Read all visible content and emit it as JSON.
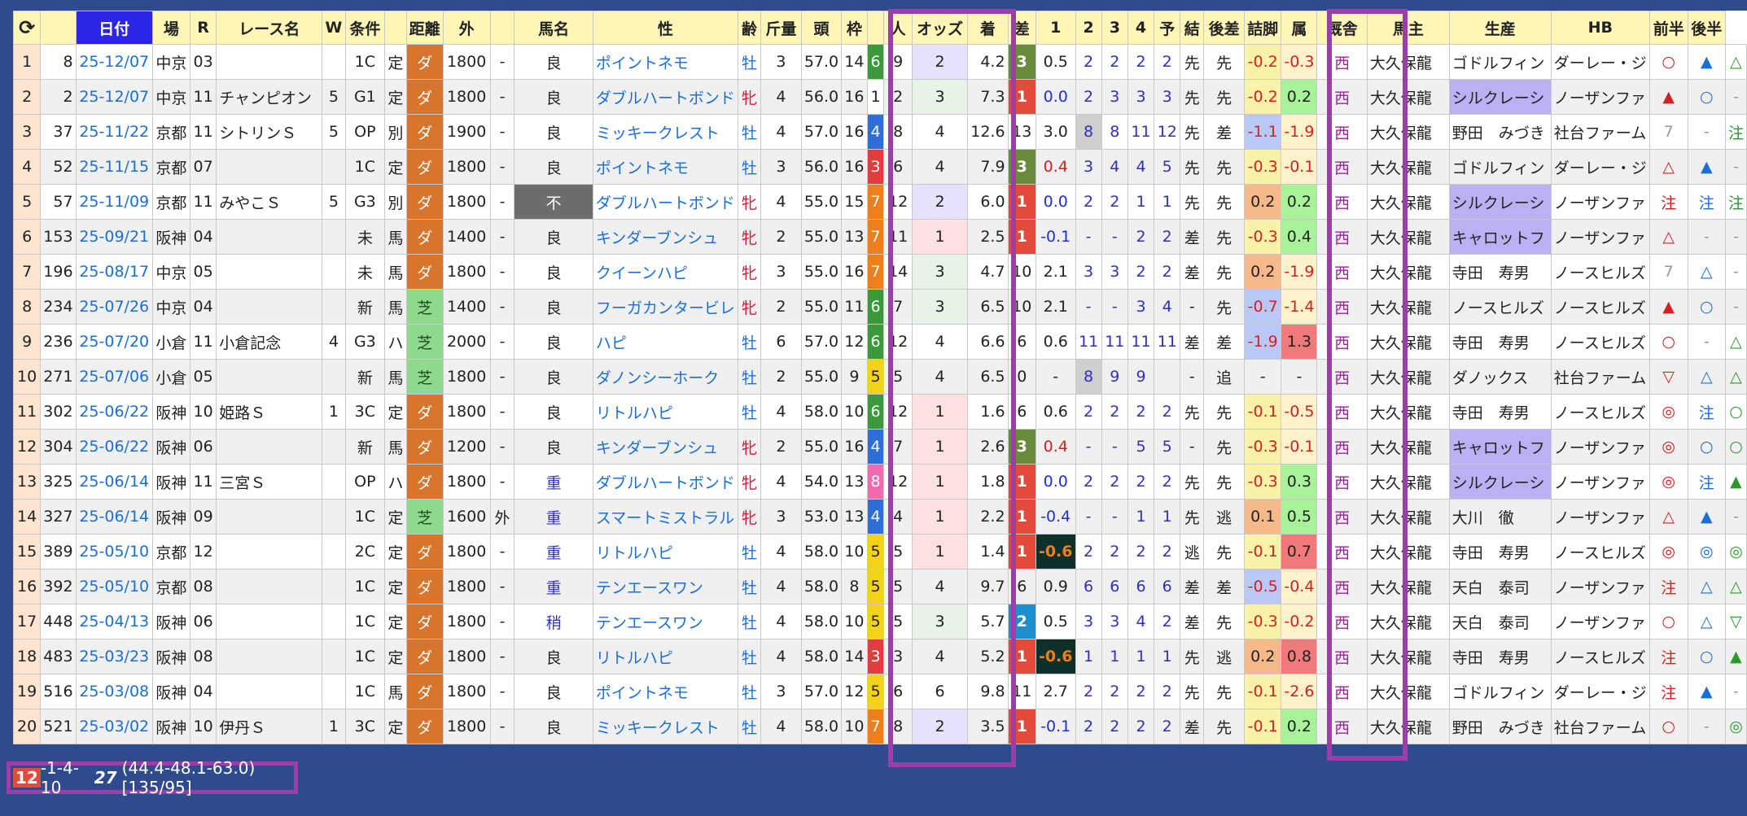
{
  "headers": [
    "日付",
    "場",
    "R",
    "レース名",
    "W",
    "条件",
    "",
    "距離",
    "外",
    "",
    "馬名",
    "性",
    "齢",
    "斤量",
    "頭",
    "枠",
    "",
    "人",
    "オッズ",
    "着",
    "差",
    "1",
    "2",
    "3",
    "4",
    "予",
    "結",
    "後差",
    "詰脚",
    "属",
    "厩舎",
    "馬主",
    "生産",
    "HB",
    "前半",
    "後半"
  ],
  "refresh_icon": "refresh-icon",
  "rows": [
    {
      "n": "1",
      "id": "8",
      "date": "25-12/07",
      "track": "中京",
      "r": "03",
      "race": "",
      "w": "",
      "cls": "1C",
      "cond": "定",
      "surf": "ダ",
      "dist": "1800",
      "out": "-",
      "g": "良",
      "horse": "ポイントネモ",
      "sex": "牡",
      "age": "3",
      "wt": "57.0",
      "hd": "14",
      "waku": "6",
      "no": "9",
      "pop": "2",
      "odds": "4.2",
      "fin": "3",
      "gap": "0.5",
      "c1": "2",
      "c2": "2",
      "c3": "2",
      "c4": "2",
      "pr": "先",
      "rs": "先",
      "diff": "-0.2",
      "ag": "-0.3",
      "zk": "西",
      "stable": "大久保龍",
      "owner": "ゴドルフィン",
      "breed": "ダーレー・ジ",
      "hb": "○",
      "f1": "▲",
      "f2": "△"
    },
    {
      "n": "2",
      "id": "2",
      "date": "25-12/07",
      "track": "中京",
      "r": "11",
      "race": "チャンピオン",
      "w": "5",
      "cls": "G1",
      "cond": "定",
      "surf": "ダ",
      "dist": "1800",
      "out": "-",
      "g": "良",
      "horse": "ダブルハートボンド",
      "sex": "牝",
      "age": "4",
      "wt": "56.0",
      "hd": "16",
      "waku": "1",
      "no": "2",
      "pop": "3",
      "odds": "7.3",
      "fin": "1",
      "gap": "0.0",
      "c1": "2",
      "c2": "3",
      "c3": "3",
      "c4": "3",
      "pr": "先",
      "rs": "先",
      "diff": "-0.2",
      "ag": "0.2",
      "zk": "西",
      "stable": "大久保龍",
      "owner": "シルクレーシ",
      "breed": "ノーザンファ",
      "hb": "▲",
      "f1": "○",
      "f2": "-"
    },
    {
      "n": "3",
      "id": "37",
      "date": "25-11/22",
      "track": "京都",
      "r": "11",
      "race": "シトリンＳ",
      "w": "5",
      "cls": "OP",
      "cond": "別",
      "surf": "ダ",
      "dist": "1900",
      "out": "-",
      "g": "良",
      "horse": "ミッキークレスト",
      "sex": "牡",
      "age": "4",
      "wt": "57.0",
      "hd": "16",
      "waku": "4",
      "no": "8",
      "pop": "4",
      "odds": "12.6",
      "fin": "13",
      "gap": "3.0",
      "c1": "8",
      "c2": "8",
      "c3": "11",
      "c4": "12",
      "pr": "先",
      "rs": "差",
      "diff": "-1.1",
      "ag": "-1.9",
      "zk": "西",
      "stable": "大久保龍",
      "owner": "野田　みづき",
      "breed": "社台ファーム",
      "hb": "7",
      "f1": "-",
      "f2": "注"
    },
    {
      "n": "4",
      "id": "52",
      "date": "25-11/15",
      "track": "京都",
      "r": "07",
      "race": "",
      "w": "",
      "cls": "1C",
      "cond": "定",
      "surf": "ダ",
      "dist": "1800",
      "out": "-",
      "g": "良",
      "horse": "ポイントネモ",
      "sex": "牡",
      "age": "3",
      "wt": "56.0",
      "hd": "16",
      "waku": "3",
      "no": "6",
      "pop": "4",
      "odds": "7.9",
      "fin": "3",
      "gap": "0.4",
      "c1": "3",
      "c2": "4",
      "c3": "4",
      "c4": "5",
      "pr": "先",
      "rs": "先",
      "diff": "-0.3",
      "ag": "-0.1",
      "zk": "西",
      "stable": "大久保龍",
      "owner": "ゴドルフィン",
      "breed": "ダーレー・ジ",
      "hb": "△",
      "f1": "▲",
      "f2": "-"
    },
    {
      "n": "5",
      "id": "57",
      "date": "25-11/09",
      "track": "京都",
      "r": "11",
      "race": "みやこＳ",
      "w": "5",
      "cls": "G3",
      "cond": "別",
      "surf": "ダ",
      "dist": "1800",
      "out": "-",
      "g": "不",
      "horse": "ダブルハートボンド",
      "sex": "牝",
      "age": "4",
      "wt": "55.0",
      "hd": "15",
      "waku": "7",
      "no": "12",
      "pop": "2",
      "odds": "6.0",
      "fin": "1",
      "gap": "0.0",
      "c1": "2",
      "c2": "2",
      "c3": "1",
      "c4": "1",
      "pr": "先",
      "rs": "先",
      "diff": "0.2",
      "ag": "0.2",
      "zk": "西",
      "stable": "大久保龍",
      "owner": "シルクレーシ",
      "breed": "ノーザンファ",
      "hb": "注",
      "f1": "注",
      "f2": "注"
    },
    {
      "n": "6",
      "id": "153",
      "date": "25-09/21",
      "track": "阪神",
      "r": "04",
      "race": "",
      "w": "",
      "cls": "未",
      "cond": "馬",
      "surf": "ダ",
      "dist": "1400",
      "out": "-",
      "g": "良",
      "horse": "キンダーブンシュ",
      "sex": "牝",
      "age": "2",
      "wt": "55.0",
      "hd": "13",
      "waku": "7",
      "no": "11",
      "pop": "1",
      "odds": "2.5",
      "fin": "1",
      "gap": "-0.1",
      "c1": "-",
      "c2": "-",
      "c3": "2",
      "c4": "2",
      "pr": "差",
      "rs": "先",
      "diff": "-0.3",
      "ag": "0.4",
      "zk": "西",
      "stable": "大久保龍",
      "owner": "キャロットフ",
      "breed": "ノーザンファ",
      "hb": "△",
      "f1": "-",
      "f2": "-"
    },
    {
      "n": "7",
      "id": "196",
      "date": "25-08/17",
      "track": "中京",
      "r": "05",
      "race": "",
      "w": "",
      "cls": "未",
      "cond": "馬",
      "surf": "ダ",
      "dist": "1800",
      "out": "-",
      "g": "良",
      "horse": "クイーンハピ",
      "sex": "牝",
      "age": "3",
      "wt": "55.0",
      "hd": "16",
      "waku": "7",
      "no": "14",
      "pop": "3",
      "odds": "4.7",
      "fin": "10",
      "gap": "2.1",
      "c1": "3",
      "c2": "3",
      "c3": "2",
      "c4": "2",
      "pr": "差",
      "rs": "先",
      "diff": "0.2",
      "ag": "-1.9",
      "zk": "西",
      "stable": "大久保龍",
      "owner": "寺田　寿男",
      "breed": "ノースヒルズ",
      "hb": "7",
      "f1": "△",
      "f2": "-"
    },
    {
      "n": "8",
      "id": "234",
      "date": "25-07/26",
      "track": "中京",
      "r": "04",
      "race": "",
      "w": "",
      "cls": "新",
      "cond": "馬",
      "surf": "芝",
      "dist": "1400",
      "out": "-",
      "g": "良",
      "horse": "フーガカンタービレ",
      "sex": "牝",
      "age": "2",
      "wt": "55.0",
      "hd": "11",
      "waku": "6",
      "no": "7",
      "pop": "3",
      "odds": "6.5",
      "fin": "10",
      "gap": "2.1",
      "c1": "-",
      "c2": "-",
      "c3": "3",
      "c4": "4",
      "pr": "-",
      "rs": "先",
      "diff": "-0.7",
      "ag": "-1.4",
      "zk": "西",
      "stable": "大久保龍",
      "owner": "ノースヒルズ",
      "breed": "ノースヒルズ",
      "hb": "▲",
      "f1": "○",
      "f2": "-"
    },
    {
      "n": "9",
      "id": "236",
      "date": "25-07/20",
      "track": "小倉",
      "r": "11",
      "race": "小倉記念",
      "w": "4",
      "cls": "G3",
      "cond": "ハ",
      "surf": "芝",
      "dist": "2000",
      "out": "-",
      "g": "良",
      "horse": "ハピ",
      "sex": "牡",
      "age": "6",
      "wt": "57.0",
      "hd": "12",
      "waku": "6",
      "no": "12",
      "pop": "4",
      "odds": "6.6",
      "fin": "6",
      "gap": "0.6",
      "c1": "11",
      "c2": "11",
      "c3": "11",
      "c4": "11",
      "pr": "差",
      "rs": "差",
      "diff": "-1.9",
      "ag": "1.3",
      "zk": "西",
      "stable": "大久保龍",
      "owner": "寺田　寿男",
      "breed": "ノースヒルズ",
      "hb": "○",
      "f1": "-",
      "f2": "△"
    },
    {
      "n": "10",
      "id": "271",
      "date": "25-07/06",
      "track": "小倉",
      "r": "05",
      "race": "",
      "w": "",
      "cls": "新",
      "cond": "馬",
      "surf": "芝",
      "dist": "1800",
      "out": "-",
      "g": "良",
      "horse": "ダノンシーホーク",
      "sex": "牡",
      "age": "2",
      "wt": "55.0",
      "hd": "9",
      "waku": "5",
      "no": "5",
      "pop": "4",
      "odds": "6.5",
      "fin": "0",
      "gap": "-",
      "c1": "8",
      "c2": "9",
      "c3": "9",
      "c4": "",
      "pr": "-",
      "rs": "追",
      "diff": "-",
      "ag": "-",
      "zk": "西",
      "stable": "大久保龍",
      "owner": "ダノックス",
      "breed": "社台ファーム",
      "hb": "▽",
      "f1": "△",
      "f2": "△"
    },
    {
      "n": "11",
      "id": "302",
      "date": "25-06/22",
      "track": "阪神",
      "r": "10",
      "race": "姫路Ｓ",
      "w": "1",
      "cls": "3C",
      "cond": "定",
      "surf": "ダ",
      "dist": "1800",
      "out": "-",
      "g": "良",
      "horse": "リトルハピ",
      "sex": "牡",
      "age": "4",
      "wt": "58.0",
      "hd": "10",
      "waku": "6",
      "no": "12",
      "pop": "1",
      "odds": "1.6",
      "fin": "6",
      "gap": "0.6",
      "c1": "2",
      "c2": "2",
      "c3": "2",
      "c4": "2",
      "pr": "先",
      "rs": "先",
      "diff": "-0.1",
      "ag": "-0.5",
      "zk": "西",
      "stable": "大久保龍",
      "owner": "寺田　寿男",
      "breed": "ノースヒルズ",
      "hb": "◎",
      "f1": "注",
      "f2": "○"
    },
    {
      "n": "12",
      "id": "304",
      "date": "25-06/22",
      "track": "阪神",
      "r": "06",
      "race": "",
      "w": "",
      "cls": "新",
      "cond": "馬",
      "surf": "ダ",
      "dist": "1200",
      "out": "-",
      "g": "良",
      "horse": "キンダーブンシュ",
      "sex": "牝",
      "age": "2",
      "wt": "55.0",
      "hd": "16",
      "waku": "4",
      "no": "7",
      "pop": "1",
      "odds": "2.6",
      "fin": "3",
      "gap": "0.4",
      "c1": "-",
      "c2": "-",
      "c3": "5",
      "c4": "5",
      "pr": "-",
      "rs": "先",
      "diff": "-0.3",
      "ag": "-0.1",
      "zk": "西",
      "stable": "大久保龍",
      "owner": "キャロットフ",
      "breed": "ノーザンファ",
      "hb": "◎",
      "f1": "○",
      "f2": "○"
    },
    {
      "n": "13",
      "id": "325",
      "date": "25-06/14",
      "track": "阪神",
      "r": "11",
      "race": "三宮Ｓ",
      "w": "",
      "cls": "OP",
      "cond": "ハ",
      "surf": "ダ",
      "dist": "1800",
      "out": "-",
      "g": "重",
      "horse": "ダブルハートボンド",
      "sex": "牝",
      "age": "4",
      "wt": "54.0",
      "hd": "13",
      "waku": "8",
      "no": "12",
      "pop": "1",
      "odds": "1.8",
      "fin": "1",
      "gap": "0.0",
      "c1": "2",
      "c2": "2",
      "c3": "2",
      "c4": "2",
      "pr": "先",
      "rs": "先",
      "diff": "-0.3",
      "ag": "0.3",
      "zk": "西",
      "stable": "大久保龍",
      "owner": "シルクレーシ",
      "breed": "ノーザンファ",
      "hb": "◎",
      "f1": "注",
      "f2": "▲"
    },
    {
      "n": "14",
      "id": "327",
      "date": "25-06/14",
      "track": "阪神",
      "r": "09",
      "race": "",
      "w": "",
      "cls": "1C",
      "cond": "定",
      "surf": "芝",
      "dist": "1600",
      "out": "外",
      "g": "重",
      "horse": "スマートミストラル",
      "sex": "牝",
      "age": "3",
      "wt": "53.0",
      "hd": "13",
      "waku": "4",
      "no": "4",
      "pop": "1",
      "odds": "2.2",
      "fin": "1",
      "gap": "-0.4",
      "c1": "-",
      "c2": "-",
      "c3": "1",
      "c4": "1",
      "pr": "先",
      "rs": "逃",
      "diff": "0.1",
      "ag": "0.5",
      "zk": "西",
      "stable": "大久保龍",
      "owner": "大川　徹",
      "breed": "ノーザンファ",
      "hb": "△",
      "f1": "▲",
      "f2": "-"
    },
    {
      "n": "15",
      "id": "389",
      "date": "25-05/10",
      "track": "京都",
      "r": "12",
      "race": "",
      "w": "",
      "cls": "2C",
      "cond": "定",
      "surf": "ダ",
      "dist": "1800",
      "out": "-",
      "g": "重",
      "horse": "リトルハピ",
      "sex": "牡",
      "age": "4",
      "wt": "58.0",
      "hd": "10",
      "waku": "5",
      "no": "5",
      "pop": "1",
      "odds": "1.4",
      "fin": "1",
      "gap": "-0.6",
      "c1": "2",
      "c2": "2",
      "c3": "2",
      "c4": "2",
      "pr": "逃",
      "rs": "先",
      "diff": "-0.1",
      "ag": "0.7",
      "zk": "西",
      "stable": "大久保龍",
      "owner": "寺田　寿男",
      "breed": "ノースヒルズ",
      "hb": "◎",
      "f1": "◎",
      "f2": "◎"
    },
    {
      "n": "16",
      "id": "392",
      "date": "25-05/10",
      "track": "京都",
      "r": "08",
      "race": "",
      "w": "",
      "cls": "1C",
      "cond": "定",
      "surf": "ダ",
      "dist": "1800",
      "out": "-",
      "g": "重",
      "horse": "テンエースワン",
      "sex": "牡",
      "age": "4",
      "wt": "58.0",
      "hd": "8",
      "waku": "5",
      "no": "5",
      "pop": "4",
      "odds": "9.7",
      "fin": "6",
      "gap": "0.9",
      "c1": "6",
      "c2": "6",
      "c3": "6",
      "c4": "6",
      "pr": "差",
      "rs": "差",
      "diff": "-0.5",
      "ag": "-0.4",
      "zk": "西",
      "stable": "大久保龍",
      "owner": "天白　泰司",
      "breed": "ノーザンファ",
      "hb": "注",
      "f1": "△",
      "f2": "△"
    },
    {
      "n": "17",
      "id": "448",
      "date": "25-04/13",
      "track": "阪神",
      "r": "06",
      "race": "",
      "w": "",
      "cls": "1C",
      "cond": "定",
      "surf": "ダ",
      "dist": "1800",
      "out": "-",
      "g": "稍",
      "horse": "テンエースワン",
      "sex": "牡",
      "age": "4",
      "wt": "58.0",
      "hd": "10",
      "waku": "5",
      "no": "5",
      "pop": "3",
      "odds": "5.7",
      "fin": "2",
      "gap": "0.5",
      "c1": "3",
      "c2": "3",
      "c3": "4",
      "c4": "2",
      "pr": "差",
      "rs": "先",
      "diff": "-0.3",
      "ag": "-0.2",
      "zk": "西",
      "stable": "大久保龍",
      "owner": "天白　泰司",
      "breed": "ノーザンファ",
      "hb": "○",
      "f1": "△",
      "f2": "▽"
    },
    {
      "n": "18",
      "id": "483",
      "date": "25-03/23",
      "track": "阪神",
      "r": "08",
      "race": "",
      "w": "",
      "cls": "1C",
      "cond": "定",
      "surf": "ダ",
      "dist": "1800",
      "out": "-",
      "g": "良",
      "horse": "リトルハピ",
      "sex": "牡",
      "age": "4",
      "wt": "58.0",
      "hd": "14",
      "waku": "3",
      "no": "3",
      "pop": "4",
      "odds": "5.2",
      "fin": "1",
      "gap": "-0.6",
      "c1": "1",
      "c2": "1",
      "c3": "1",
      "c4": "1",
      "pr": "先",
      "rs": "逃",
      "diff": "0.2",
      "ag": "0.8",
      "zk": "西",
      "stable": "大久保龍",
      "owner": "寺田　寿男",
      "breed": "ノースヒルズ",
      "hb": "注",
      "f1": "○",
      "f2": "▲"
    },
    {
      "n": "19",
      "id": "516",
      "date": "25-03/08",
      "track": "阪神",
      "r": "04",
      "race": "",
      "w": "",
      "cls": "1C",
      "cond": "馬",
      "surf": "ダ",
      "dist": "1800",
      "out": "-",
      "g": "良",
      "horse": "ポイントネモ",
      "sex": "牡",
      "age": "3",
      "wt": "57.0",
      "hd": "12",
      "waku": "5",
      "no": "6",
      "pop": "6",
      "odds": "9.8",
      "fin": "11",
      "gap": "2.7",
      "c1": "2",
      "c2": "2",
      "c3": "2",
      "c4": "2",
      "pr": "先",
      "rs": "先",
      "diff": "-0.1",
      "ag": "-2.6",
      "zk": "西",
      "stable": "大久保龍",
      "owner": "ゴドルフィン",
      "breed": "ダーレー・ジ",
      "hb": "注",
      "f1": "▲",
      "f2": "-"
    },
    {
      "n": "20",
      "id": "521",
      "date": "25-03/02",
      "track": "阪神",
      "r": "10",
      "race": "伊丹Ｓ",
      "w": "1",
      "cls": "3C",
      "cond": "定",
      "surf": "ダ",
      "dist": "1800",
      "out": "-",
      "g": "良",
      "horse": "ミッキークレスト",
      "sex": "牡",
      "age": "4",
      "wt": "58.0",
      "hd": "10",
      "waku": "7",
      "no": "8",
      "pop": "2",
      "odds": "3.5",
      "fin": "1",
      "gap": "-0.1",
      "c1": "2",
      "c2": "2",
      "c3": "2",
      "c4": "2",
      "pr": "差",
      "rs": "先",
      "diff": "-0.1",
      "ag": "0.2",
      "zk": "西",
      "stable": "大久保龍",
      "owner": "野田　みづき",
      "breed": "社台ファーム",
      "hb": "○",
      "f1": "-",
      "f2": "◎"
    }
  ],
  "summary": {
    "wins": "12",
    "record": "-1-4-10",
    "total": "27",
    "rates": "(44.4-48.1-63.0) [135/95]"
  },
  "colors": {
    "background": "#2f4b8f",
    "highlight": "#9d3da8",
    "sorted_header": "#2d25e6"
  }
}
